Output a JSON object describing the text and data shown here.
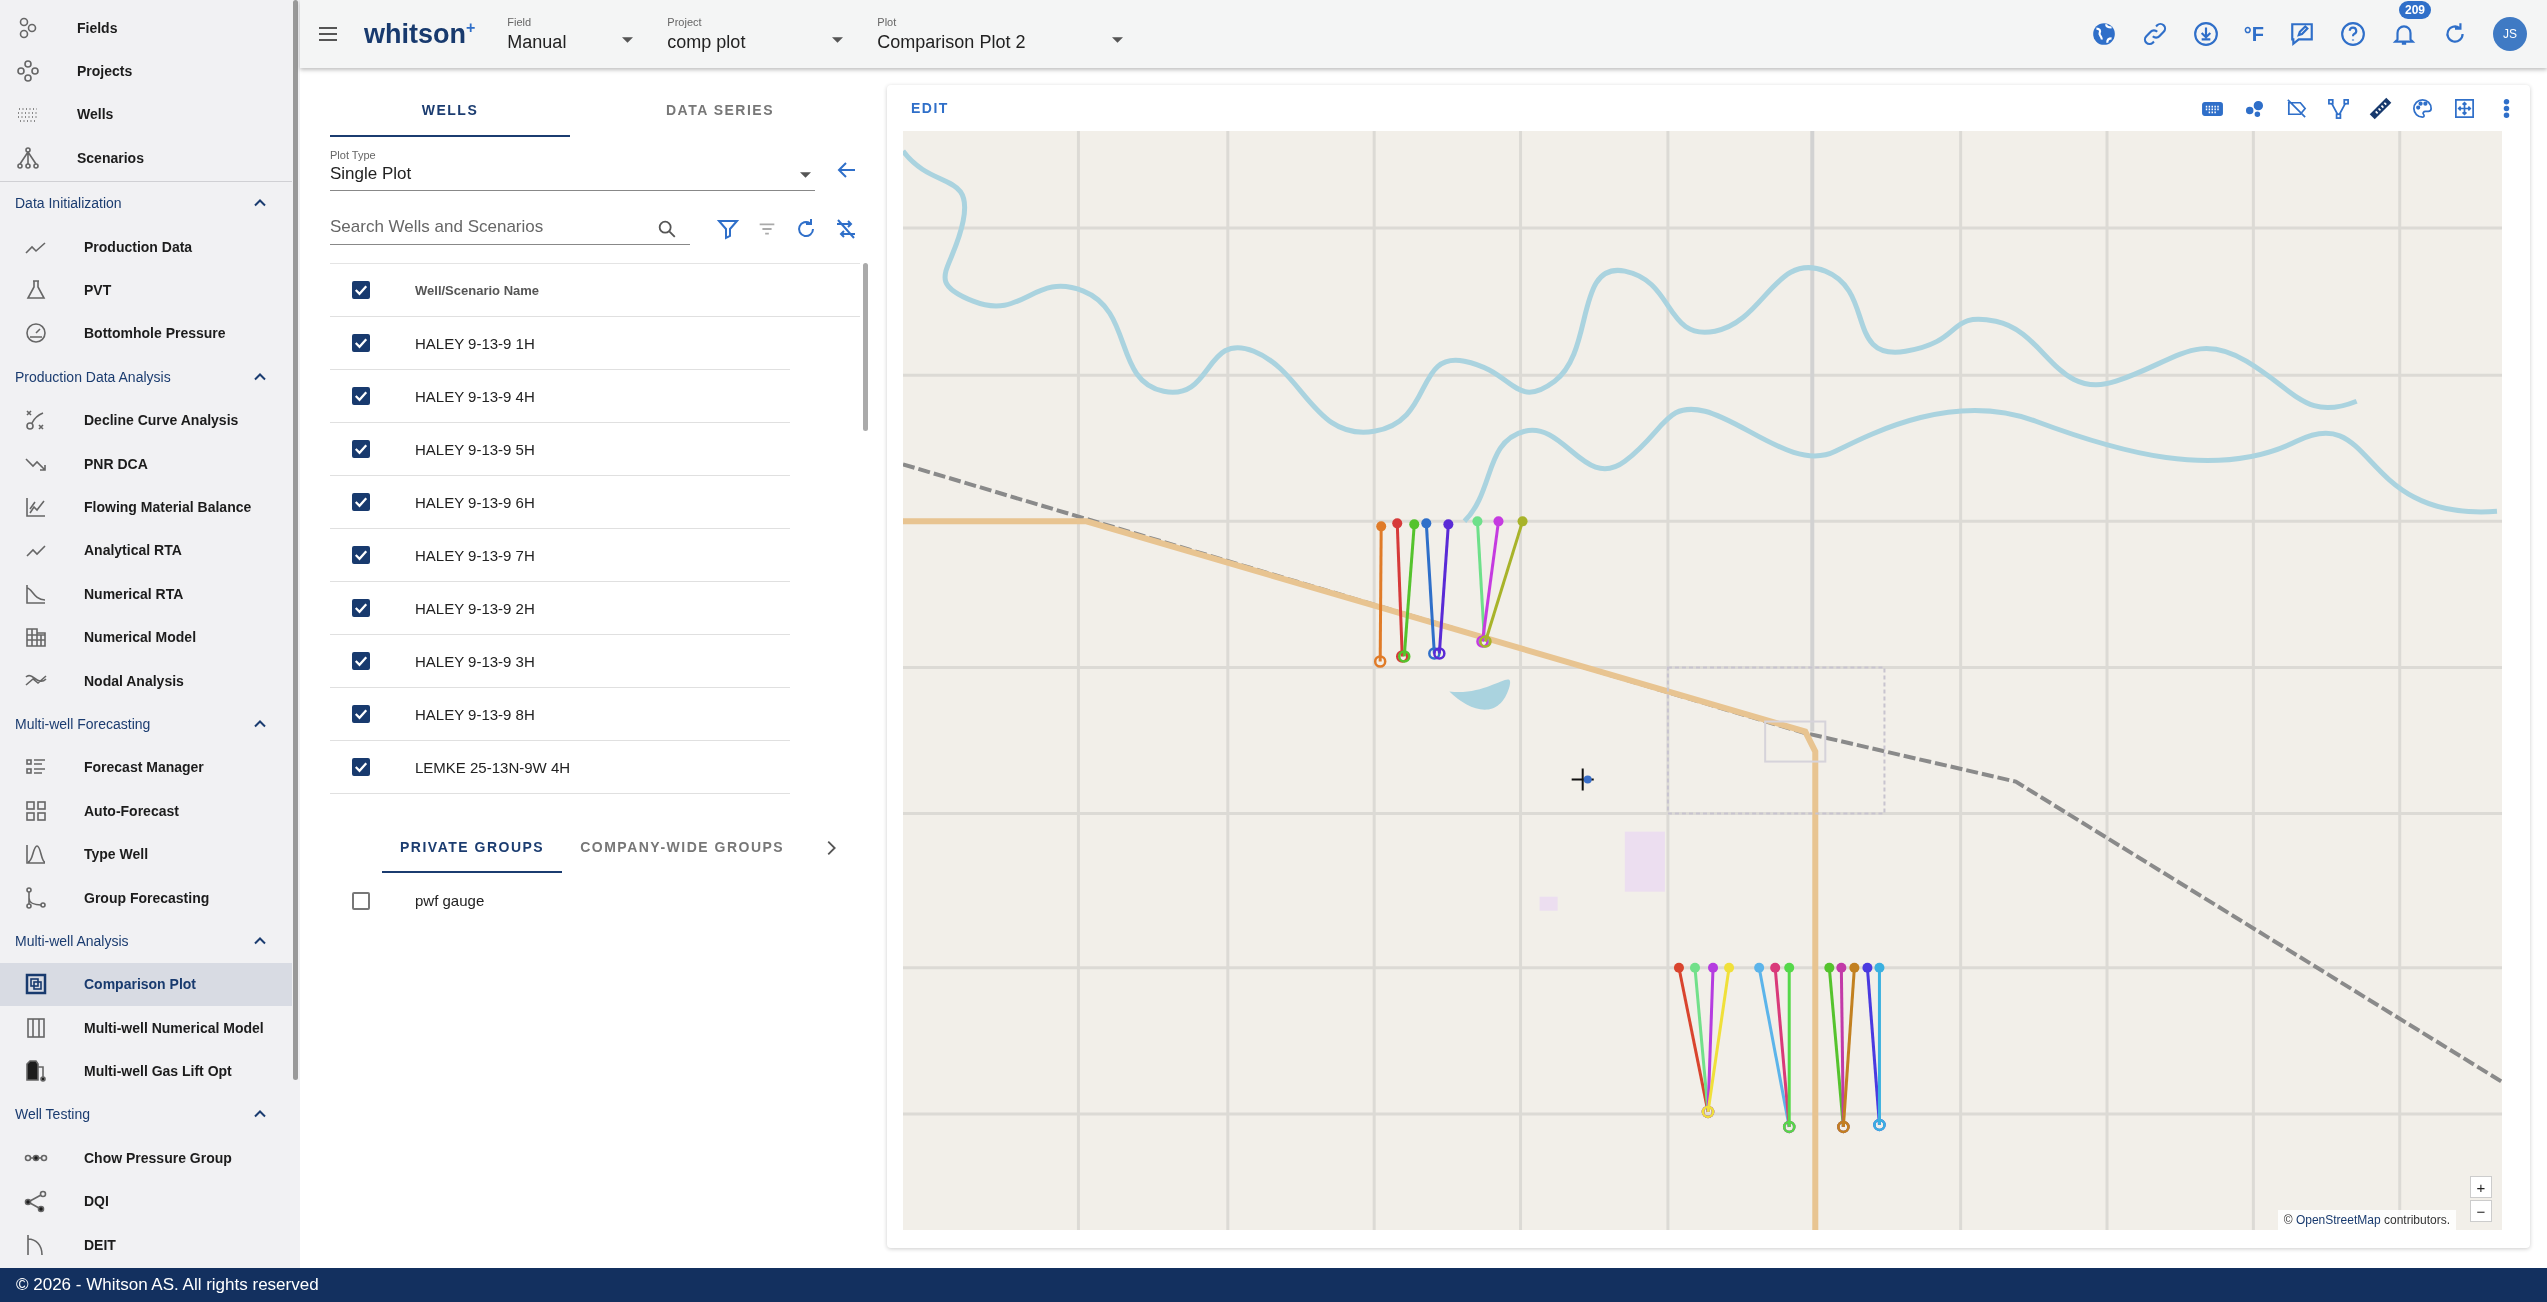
{
  "app": {
    "logo": "whitson$^{+}$"
  },
  "sidebar": {
    "top_items": [
      {
        "label": "Fields",
        "selected": false
      },
      {
        "label": "Projects",
        "selected": false
      },
      {
        "label": "Wells",
        "selected": false
      },
      {
        "label": "Scenarios",
        "selected": false
      }
    ],
    "sections": [
      {
        "title": "Data Initialization",
        "expanded": true,
        "items": [
          {
            "label": "Production Data",
            "selected": false
          },
          {
            "label": "PVT",
            "selected": false
          },
          {
            "label": "Bottomhole Pressure",
            "selected": false
          }
        ]
      },
      {
        "title": "Production Data Analysis",
        "expanded": true,
        "items": [
          {
            "label": "Decline Curve Analysis",
            "selected": false
          },
          {
            "label": "PNR DCA",
            "selected": false
          },
          {
            "label": "Flowing Material Balance",
            "selected": false
          },
          {
            "label": "Analytical RTA",
            "selected": false
          },
          {
            "label": "Numerical RTA",
            "selected": false
          },
          {
            "label": "Numerical Model",
            "selected": false
          },
          {
            "label": "Nodal Analysis",
            "selected": false
          }
        ]
      },
      {
        "title": "Multi-well Forecasting",
        "expanded": true,
        "items": [
          {
            "label": "Forecast Manager",
            "selected": false
          },
          {
            "label": "Auto-Forecast",
            "selected": false
          },
          {
            "label": "Type Well",
            "selected": false
          },
          {
            "label": "Group Forecasting",
            "selected": false
          }
        ]
      },
      {
        "title": "Multi-well Analysis",
        "expanded": true,
        "items": [
          {
            "label": "Comparison Plot",
            "selected": true
          },
          {
            "label": "Multi-well Numerical Model",
            "selected": false
          },
          {
            "label": "Multi-well Gas Lift Opt",
            "selected": false
          }
        ]
      },
      {
        "title": "Well Testing",
        "expanded": true,
        "items": [
          {
            "label": "Chow Pressure Group",
            "selected": false
          },
          {
            "label": "DQI",
            "selected": false
          },
          {
            "label": "DEIT",
            "selected": false
          }
        ]
      }
    ]
  },
  "top_bar": {
    "selectors": [
      {
        "label": "Field",
        "value": "Manual"
      },
      {
        "label": "Project",
        "value": "comp plot"
      },
      {
        "label": "Plot",
        "value": "Comparison Plot 2"
      }
    ],
    "unit_label": "°F",
    "notification_count": "209",
    "avatar_initials": "JS"
  },
  "left_panel": {
    "tabs": [
      {
        "label": "WELLS",
        "selected": true
      },
      {
        "label": "DATA SERIES",
        "selected": false
      }
    ],
    "plot_type": {
      "label": "Plot Type",
      "value": "Single Plot"
    },
    "search": {
      "placeholder": "Search Wells and Scenarios"
    },
    "table": {
      "header": "Well/Scenario Name",
      "all_checked": true,
      "rows": [
        {
          "name": "HALEY 9-13-9 1H",
          "checked": true
        },
        {
          "name": "HALEY 9-13-9 4H",
          "checked": true
        },
        {
          "name": "HALEY 9-13-9 5H",
          "checked": true
        },
        {
          "name": "HALEY 9-13-9 6H",
          "checked": true
        },
        {
          "name": "HALEY 9-13-9 7H",
          "checked": true
        },
        {
          "name": "HALEY 9-13-9 2H",
          "checked": true
        },
        {
          "name": "HALEY 9-13-9 3H",
          "checked": true
        },
        {
          "name": "HALEY 9-13-9 8H",
          "checked": true
        },
        {
          "name": "LEMKE 25-13N-9W 4H",
          "checked": true
        }
      ]
    },
    "group_tabs": [
      {
        "label": "PRIVATE GROUPS",
        "selected": true
      },
      {
        "label": "COMPANY-WIDE GROUPS",
        "selected": false
      }
    ],
    "groups": [
      {
        "name": "pwf gauge",
        "checked": false
      }
    ]
  },
  "map_panel": {
    "edit_label": "EDIT",
    "attribution_prefix": "©",
    "attribution_link": "OpenStreetMap",
    "attribution_suffix": "contributors.",
    "zoom_in": "+",
    "zoom_out": "−"
  },
  "footer": {
    "text": "© 2026 - Whitson AS. All rights reserved"
  }
}
